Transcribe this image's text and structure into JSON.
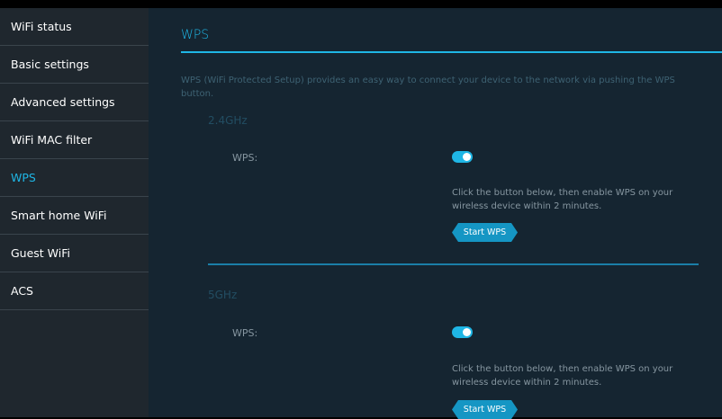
{
  "sidebar": {
    "items": [
      {
        "label": "WiFi status"
      },
      {
        "label": "Basic settings"
      },
      {
        "label": "Advanced settings"
      },
      {
        "label": "WiFi MAC filter"
      },
      {
        "label": "WPS"
      },
      {
        "label": "Smart home WiFi"
      },
      {
        "label": "Guest WiFi"
      },
      {
        "label": "ACS"
      }
    ],
    "active_item": "WPS"
  },
  "main": {
    "title": "WPS",
    "description": "WPS (WiFi Protected Setup) provides an easy way to connect your device to the network via pushing the WPS button.",
    "bands": [
      {
        "name": "2.4GHz",
        "wps_label": "WPS:",
        "wps_enabled": true,
        "hint": "Click the button below, then enable WPS on your wireless device within 2 minutes.",
        "button_label": "Start WPS"
      },
      {
        "name": "5GHz",
        "wps_label": "WPS:",
        "wps_enabled": true,
        "hint": "Click the button below, then enable WPS on your wireless device within 2 minutes.",
        "button_label": "Start WPS"
      }
    ]
  },
  "colors": {
    "accent": "#1fb6e5",
    "sidebar_bg": "#1f272e",
    "main_bg": "#152531",
    "button_bg": "#1596c4"
  }
}
